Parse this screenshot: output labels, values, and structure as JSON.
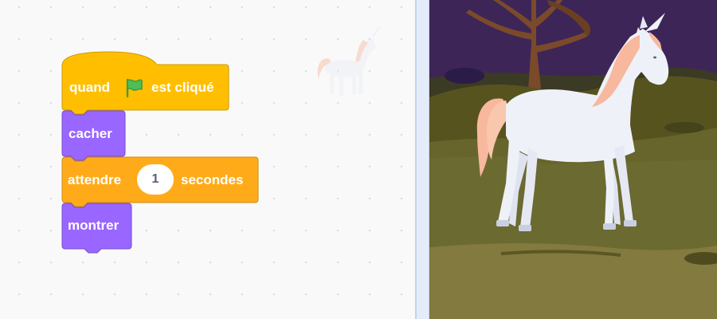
{
  "script": {
    "hat_block": {
      "label_before": "quand",
      "flag_icon": "green-flag-icon",
      "label_after": "est cliqué"
    },
    "hide_block": {
      "label": "cacher"
    },
    "wait_block": {
      "label_before": "attendre",
      "value": "1",
      "label_after": "secondes"
    },
    "show_block": {
      "label": "montrer"
    }
  },
  "colors": {
    "events": "#ffbf00",
    "events_border": "#cc9900",
    "looks": "#9966ff",
    "looks_border": "#774dcb",
    "control": "#ffab19",
    "control_border": "#cf8b17",
    "flag": "#4cbf56"
  },
  "stage": {
    "sprite": "unicorn",
    "backdrop": "night-forest-meadow"
  }
}
